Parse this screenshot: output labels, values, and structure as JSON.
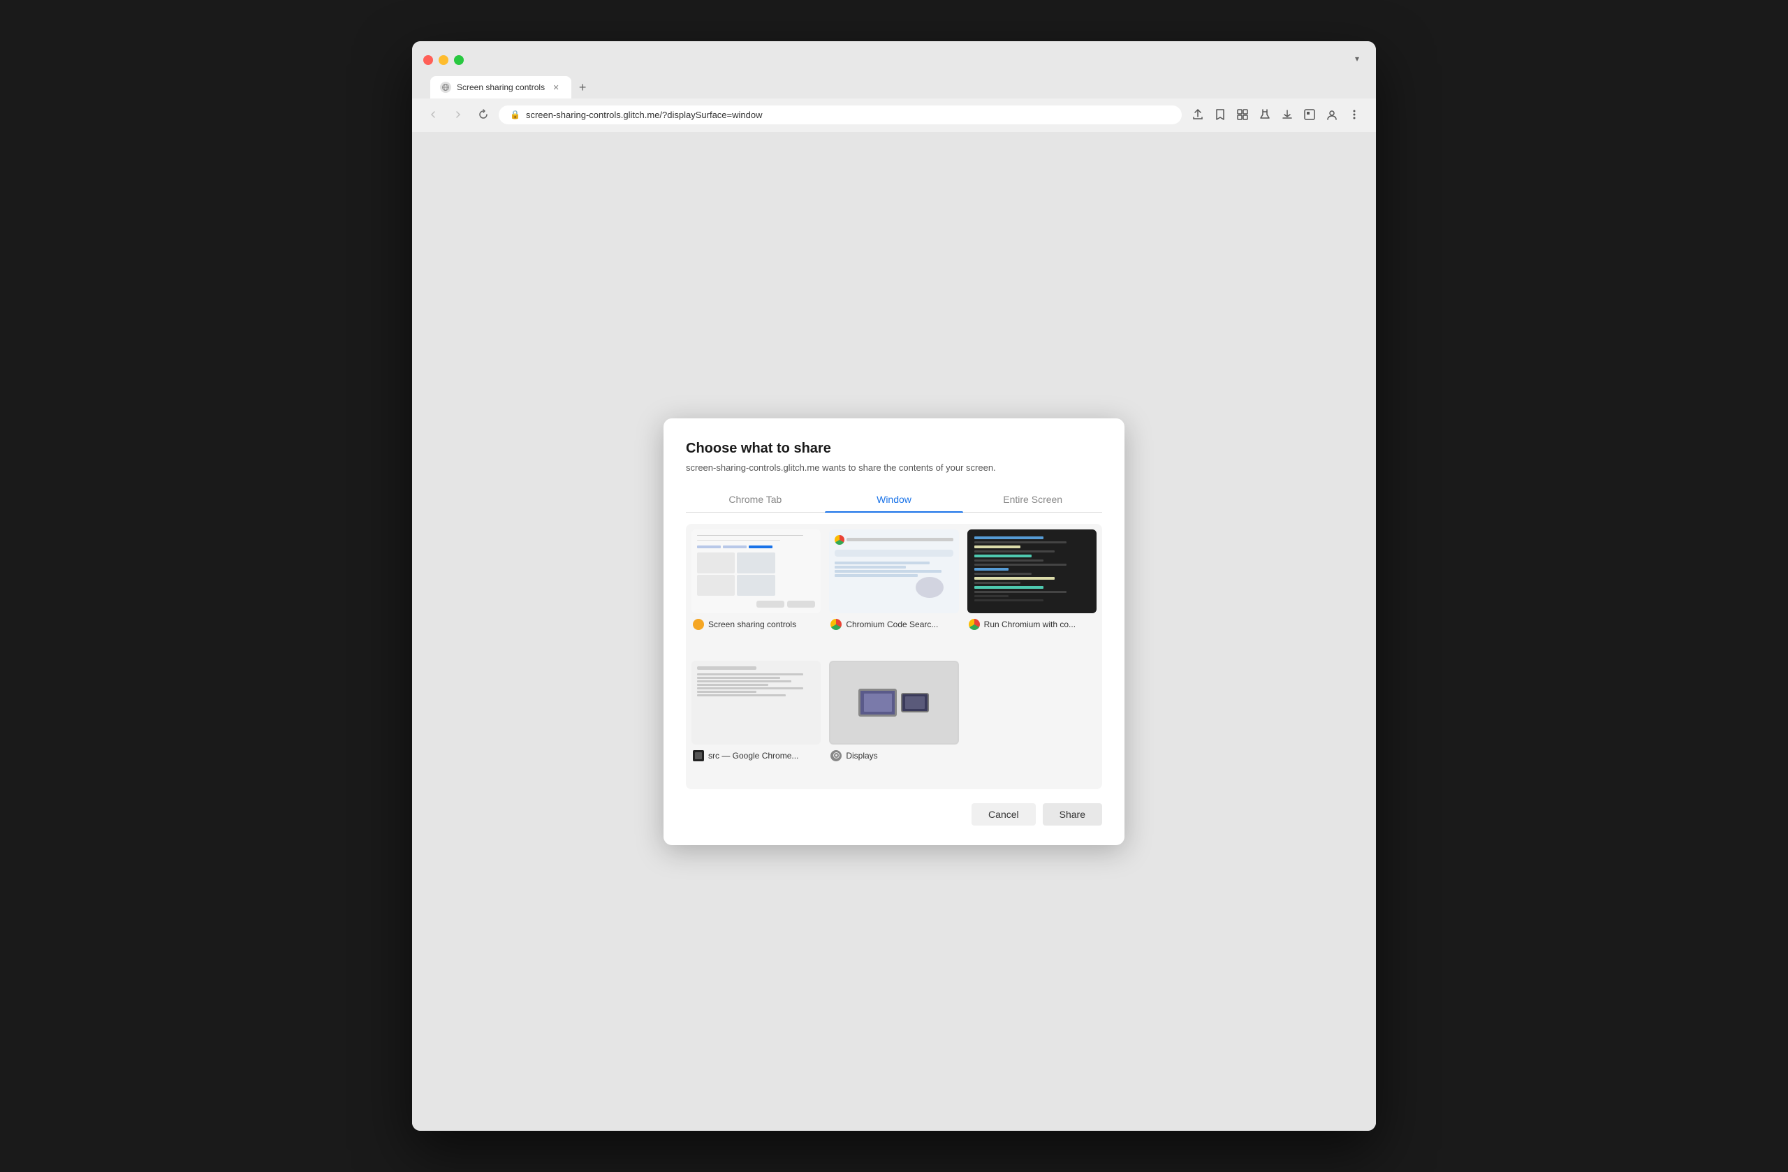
{
  "browser": {
    "tab_title": "Screen sharing controls",
    "tab_new_label": "+",
    "dropdown_label": "▾",
    "address": "screen-sharing-controls.glitch.me/?displaySurface=window",
    "nav": {
      "back_disabled": true,
      "forward_disabled": true
    }
  },
  "dialog": {
    "title": "Choose what to share",
    "subtitle": "screen-sharing-controls.glitch.me wants to share the contents of your screen.",
    "tabs": [
      {
        "id": "chrome-tab",
        "label": "Chrome Tab",
        "active": false
      },
      {
        "id": "window",
        "label": "Window",
        "active": true
      },
      {
        "id": "entire-screen",
        "label": "Entire Screen",
        "active": false
      }
    ],
    "windows": [
      {
        "id": "w1",
        "name": "Screen sharing controls",
        "favicon_type": "yellow",
        "favicon_color": "#f5a623"
      },
      {
        "id": "w2",
        "name": "Chromium Code Searc...",
        "favicon_type": "chrome",
        "favicon_color": "#4285f4"
      },
      {
        "id": "w3",
        "name": "Run Chromium with co...",
        "favicon_type": "chrome",
        "favicon_color": "#4285f4"
      },
      {
        "id": "w4",
        "name": "src — Google Chrome...",
        "favicon_type": "dark",
        "favicon_color": "#222222"
      },
      {
        "id": "w5",
        "name": "Displays",
        "favicon_type": "gear",
        "favicon_color": "#888888"
      }
    ],
    "footer": {
      "cancel_label": "Cancel",
      "share_label": "Share"
    }
  }
}
